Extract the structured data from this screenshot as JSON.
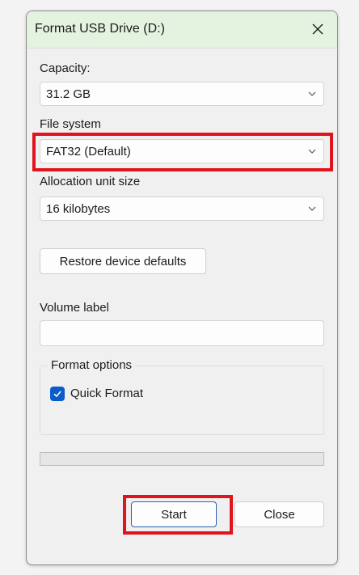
{
  "window": {
    "title": "Format USB Drive (D:)"
  },
  "capacity": {
    "label": "Capacity:",
    "value": "31.2 GB"
  },
  "file_system": {
    "label": "File system",
    "value": "FAT32 (Default)"
  },
  "allocation": {
    "label": "Allocation unit size",
    "value": "16 kilobytes"
  },
  "restore_button": "Restore device defaults",
  "volume": {
    "label": "Volume label",
    "value": ""
  },
  "format_options": {
    "legend": "Format options",
    "quick_format_label": "Quick Format",
    "quick_format_checked": true
  },
  "progress": {
    "percent": 0
  },
  "buttons": {
    "start": "Start",
    "close": "Close"
  },
  "colors": {
    "titlebar_bg": "#e4f3e0",
    "highlight": "#e0141c",
    "checkbox_accent": "#0b5ccb",
    "primary_border": "#2a64b4"
  }
}
